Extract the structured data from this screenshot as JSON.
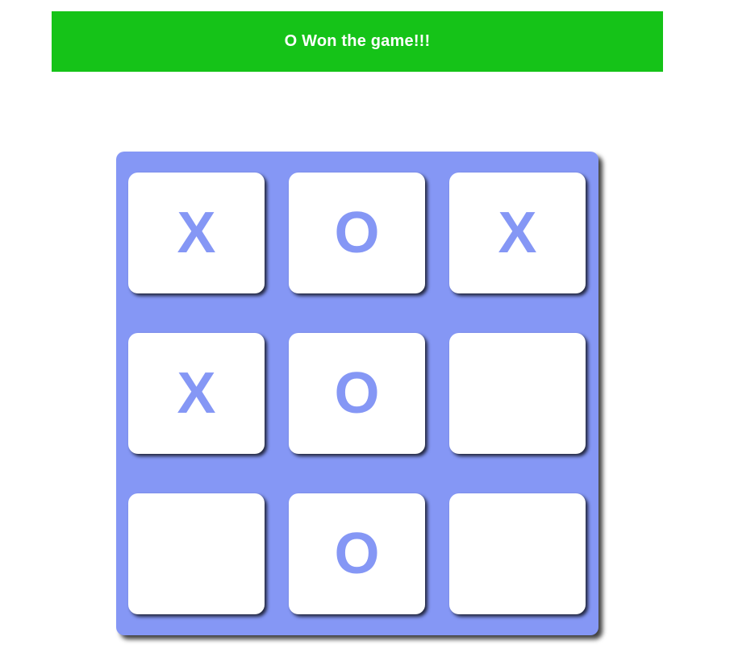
{
  "status": {
    "message": "O Won the game!!!",
    "color": "#15c318"
  },
  "board": {
    "color": "#8597f5",
    "mark_color": "#8597f5",
    "cells": [
      "X",
      "O",
      "X",
      "X",
      "O",
      "",
      "",
      "O",
      ""
    ]
  }
}
